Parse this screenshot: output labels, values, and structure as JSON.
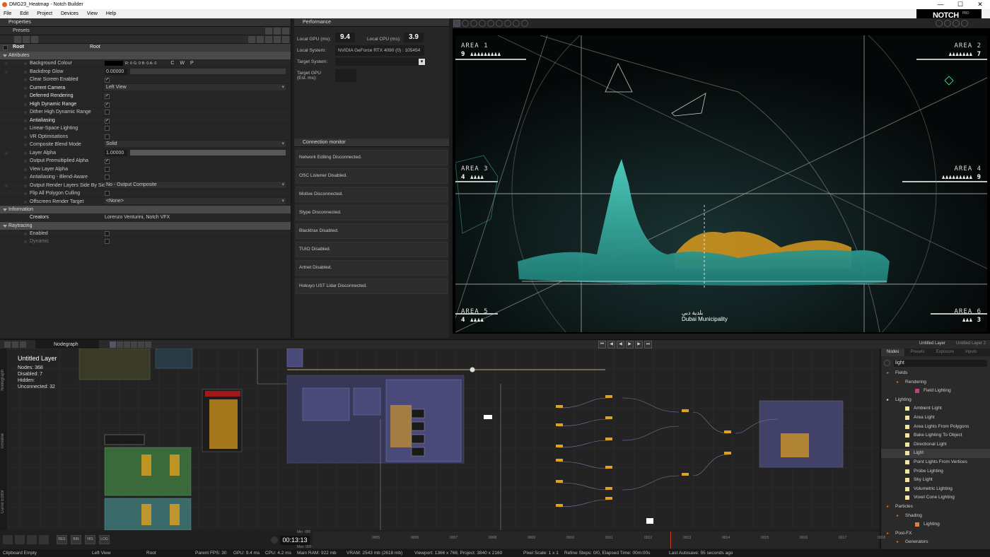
{
  "window": {
    "title": "DMG23_Heatmap - Notch Builder",
    "min": "—",
    "max": "☐",
    "close": "✕"
  },
  "menu": [
    "File",
    "Edit",
    "Project",
    "Devices",
    "View",
    "Help"
  ],
  "brand": {
    "name": "NOTCH",
    "edition": "PRO"
  },
  "properties": {
    "title": "Properties",
    "presets_label": "Presets",
    "root_label": "Root",
    "root_value": "Root",
    "sections": {
      "attributes": "Attributes",
      "information": "Information",
      "raytracing": "Raytracing"
    },
    "bg_colour": {
      "label": "Background Colour",
      "value": "R: 0  G: 0  B: 0  A: 0",
      "c": "C",
      "w": "W",
      "p": "P"
    },
    "backdrop_glow": {
      "label": "Backdrop Glow",
      "value": "0.00000"
    },
    "clear_screen": {
      "label": "Clear Screen Enabled"
    },
    "current_camera": {
      "label": "Current Camera",
      "value": "Left View"
    },
    "deferred": {
      "label": "Deferred Rendering"
    },
    "hdr": {
      "label": "High Dynamic Range"
    },
    "dither": {
      "label": "Dither High Dynamic Range"
    },
    "antialias": {
      "label": "Antialiasing"
    },
    "linear": {
      "label": "Linear-Space Lighting"
    },
    "vr": {
      "label": "VR Optimisations"
    },
    "blend": {
      "label": "Composite Blend Mode",
      "value": "Solid"
    },
    "layer_alpha": {
      "label": "Layer Alpha",
      "value": "1.00000"
    },
    "premult": {
      "label": "Output Premultiplied Alpha"
    },
    "view_alpha": {
      "label": "View Layer Alpha"
    },
    "aa_blend": {
      "label": "Antialiasing - Blend-Aware"
    },
    "side_by_side": {
      "label": "Output Render Layers Side By Side",
      "value": "No - Output Composite"
    },
    "flip_cull": {
      "label": "Flip All Polygon Culling"
    },
    "offscreen": {
      "label": "Offscreen Render Target",
      "value": "<None>"
    },
    "creators": {
      "label": "Creators",
      "value": "Lorenzo Venturini, Notch VFX"
    },
    "rt_enabled": {
      "label": "Enabled"
    },
    "rt_dynamic": {
      "label": "Dynamic"
    },
    "check": "✓"
  },
  "performance": {
    "title": "Performance",
    "local_gpu_label": "Local GPU (ms):",
    "local_gpu": "9.4",
    "local_cpu_label": "Local CPU (ms):",
    "local_cpu": "3.9",
    "local_system_label": "Local System:",
    "local_system": "NVIDIA GeForce RTX 4090 (0) : 105454",
    "target_system_label": "Target System:",
    "target_gpu_label_1": "Target GPU",
    "target_gpu_label_2": "(Est. ms):"
  },
  "connection": {
    "title": "Connection monitor",
    "items": [
      "Network Editing Disconnected.",
      "OSC Listener Disabled.",
      "Motive Disconnected.",
      "Stype Disconnected.",
      "Blacktrax Disabled.",
      "TUIO Disabled.",
      "Artnet Disabled.",
      "Hokuyo UST Lidar Disconnected."
    ]
  },
  "viewport": {
    "areas": [
      {
        "name": "AREA 1",
        "count": "9"
      },
      {
        "name": "AREA 2",
        "count": "7"
      },
      {
        "name": "AREA 3",
        "count": "4"
      },
      {
        "name": "AREA 4",
        "count": "9"
      },
      {
        "name": "AREA 5",
        "count": "4"
      },
      {
        "name": "AREA 6",
        "count": "3"
      }
    ],
    "people_a1": "♟♟♟♟♟♟♟♟♟",
    "people_a2": "♟♟♟♟♟♟♟",
    "people_a3": "♟♟♟♟",
    "people_a4": "♟♟♟♟♟♟♟♟♟",
    "people_a5": "♟♟♟♟",
    "people_a6": "♟♟♟",
    "logo_ar": "بلدية دبي",
    "logo_en": "Dubai Municipality",
    "colors": {
      "teal": "#3fb9a8",
      "orange": "#e0a020"
    }
  },
  "nodegraph": {
    "tab": "Nodegraph",
    "side_tabs": [
      "Nodegraph",
      "Timeline",
      "Curve Editor"
    ],
    "layer_name": "Untitled  Layer",
    "nodes": "Nodes:  368",
    "disabled": "Disabled:  7",
    "hidden": "Hidden:",
    "unconnected": "Unconnected:  32",
    "layer_tabs": [
      "Untitled Layer",
      "Untitled Layer 2"
    ]
  },
  "nodes_panel": {
    "tabs": [
      "Nodes",
      "Presets",
      "Exposure",
      "Inputs"
    ],
    "search": "light",
    "items": [
      {
        "label": "Fields",
        "lvl": 0,
        "type": "cat"
      },
      {
        "label": "Rendering",
        "lvl": 1,
        "type": "cat"
      },
      {
        "label": "Field Lighting",
        "lvl": 2,
        "type": "node",
        "color": "#c04080"
      },
      {
        "label": "Lighting",
        "lvl": 0,
        "type": "open"
      },
      {
        "label": "Ambient Light",
        "lvl": 1,
        "type": "node",
        "color": "#f2e6a0"
      },
      {
        "label": "Area Light",
        "lvl": 1,
        "type": "node",
        "color": "#f2e6a0"
      },
      {
        "label": "Area Lights From Polygons",
        "lvl": 1,
        "type": "node",
        "color": "#f2e6a0"
      },
      {
        "label": "Bake Lighting To Object",
        "lvl": 1,
        "type": "node",
        "color": "#f2e6a0"
      },
      {
        "label": "Directional Light",
        "lvl": 1,
        "type": "node",
        "color": "#f2e6a0"
      },
      {
        "label": "Light",
        "lvl": 1,
        "type": "node",
        "color": "#f2e6a0",
        "sel": true
      },
      {
        "label": "Point Lights From Vertices",
        "lvl": 1,
        "type": "node",
        "color": "#f2e6a0"
      },
      {
        "label": "Probe Lighting",
        "lvl": 1,
        "type": "node",
        "color": "#f2e6a0"
      },
      {
        "label": "Sky Light",
        "lvl": 1,
        "type": "node",
        "color": "#f2e6a0"
      },
      {
        "label": "Volumetric Lighting",
        "lvl": 1,
        "type": "node",
        "color": "#f2e6a0"
      },
      {
        "label": "Voxel Cone Lighting",
        "lvl": 1,
        "type": "node",
        "color": "#f2e6a0"
      },
      {
        "label": "Particles",
        "lvl": 0,
        "type": "cat"
      },
      {
        "label": "Shading",
        "lvl": 1,
        "type": "cat"
      },
      {
        "label": "Lighting",
        "lvl": 2,
        "type": "node",
        "color": "#e08040"
      },
      {
        "label": "Post-FX",
        "lvl": 0,
        "type": "cat"
      },
      {
        "label": "Generators",
        "lvl": 1,
        "type": "cat"
      }
    ]
  },
  "timeline": {
    "timecode": "00:13:13",
    "min_label": "Min: 000",
    "max_label": "Max: 000",
    "btns": [
      "RES",
      "BIN",
      "HIS",
      "LOG"
    ],
    "ticks": [
      "0005",
      "0006",
      "0007",
      "0008",
      "0009",
      "0010",
      "0011",
      "0012",
      "0013",
      "0014",
      "0015",
      "0016",
      "0017",
      "0018"
    ]
  },
  "status": {
    "clipboard": "Clipboard Empty",
    "view": "Left View",
    "root": "Root",
    "fps": "Parent  FPS: 30",
    "gpu": "GPU: 9.4 ms",
    "cpu": "CPU: 4.2 ms",
    "ram": "Main RAM: 922 mb",
    "vram": "VRAM: 2543 mb (2618 mb)",
    "viewport": "Viewport: 1366 x 768, Project: 3840 x 2160",
    "pixel": "Pixel Scale: 1 x 1",
    "refine": "Refine Steps: 0/0, Elapsed Time: 00m:00s",
    "autosave": "Last Autosave: 55 seconds ago"
  }
}
